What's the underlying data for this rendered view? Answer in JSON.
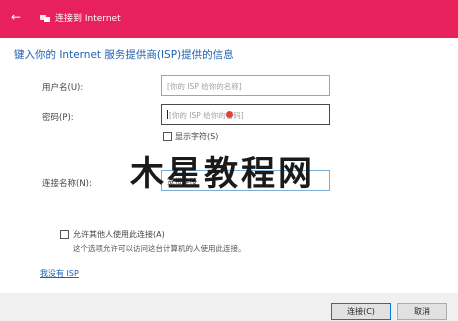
{
  "window": {
    "title": "连接到 Internet",
    "accent_color": "#e8205b",
    "back_icon": "back-arrow-icon",
    "app_icon": "network-icon"
  },
  "form": {
    "heading": "键入你的 Internet 服务提供商(ISP)提供的信息",
    "username": {
      "label": "用户名(U):",
      "placeholder": "[你的 ISP 给你的名称]"
    },
    "password": {
      "label": "密码(P):",
      "placeholder": "[你的 ISP 给你的密码]"
    },
    "show_chars": {
      "label": "显示字符(S)",
      "checked": false
    },
    "connection_name": {
      "label": "连接名称(N):",
      "value": "宽带连接"
    },
    "allow_others": {
      "label": "允许其他人使用此连接(A)",
      "checked": false,
      "hint": "这个选项允许可以访问这台计算机的人使用此连接。"
    },
    "no_isp_link": "我没有 ISP"
  },
  "watermark": "木星教程网",
  "buttons": {
    "connect": "连接(C)",
    "cancel": "取消"
  }
}
